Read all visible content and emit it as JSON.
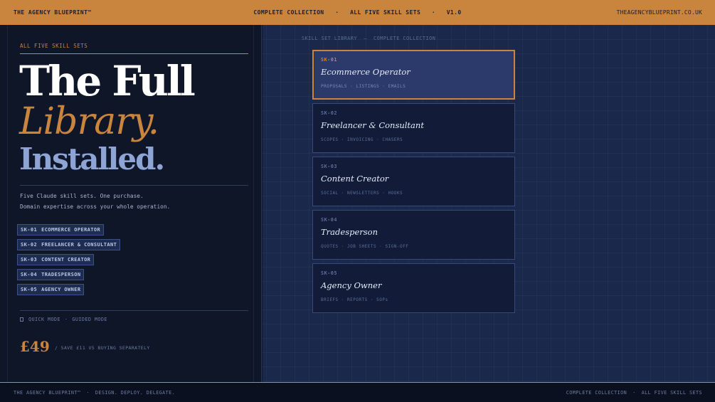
{
  "topbar": {
    "brand": "THE AGENCY BLUEPRINT™",
    "center_a": "COMPLETE COLLECTION",
    "center_b": "ALL FIVE SKILL SETS",
    "center_c": "V1.0",
    "separator": "·",
    "site": "THEAGENCYBLUEPRINT.CO.UK"
  },
  "hero": {
    "eyebrow": "ALL FIVE SKILL SETS",
    "line1": "The Full",
    "line2": "Library.",
    "line3": "Installed.",
    "desc_1": "Five Claude skill sets. One purchase.",
    "desc_2": "Domain expertise across your whole operation."
  },
  "chips": [
    {
      "code": "SK-01",
      "label": "ECOMMERCE OPERATOR"
    },
    {
      "code": "SK-02",
      "label": "FREELANCER & CONSULTANT"
    },
    {
      "code": "SK-03",
      "label": "CONTENT CREATOR"
    },
    {
      "code": "SK-04",
      "label": "TRADESPERSON"
    },
    {
      "code": "SK-05",
      "label": "AGENCY OWNER"
    }
  ],
  "modes": {
    "quick": "QUICK MODE",
    "separator": "·",
    "guided": "GUIDED MODE"
  },
  "pricing": {
    "price": "£49",
    "note": "/ SAVE £11 VS BUYING SEPARATELY"
  },
  "library": {
    "label": "SKILL SET LIBRARY",
    "separator": "—",
    "label_b": "COMPLETE COLLECTION",
    "cards": [
      {
        "code": "SK-01",
        "title": "Ecommerce Operator",
        "tags": "PROPOSALS · LISTINGS · EMAILS",
        "active": true
      },
      {
        "code": "SK-02",
        "title": "Freelancer & Consultant",
        "tags": "SCOPES · INVOICING · CHASERS",
        "active": false
      },
      {
        "code": "SK-03",
        "title": "Content Creator",
        "tags": "SOCIAL · NEWSLETTERS · HOOKS",
        "active": false
      },
      {
        "code": "SK-04",
        "title": "Tradesperson",
        "tags": "QUOTES · JOB SHEETS · SIGN-OFF",
        "active": false
      },
      {
        "code": "SK-05",
        "title": "Agency Owner",
        "tags": "BRIEFS · REPORTS · SOPs",
        "active": false
      }
    ]
  },
  "footer": {
    "brand": "THE AGENCY BLUEPRINT™",
    "separator": "·",
    "tagline": "DESIGN. DEPLOY. DELEGATE.",
    "right_a": "COMPLETE COLLECTION",
    "right_b": "ALL FIVE SKILL SETS"
  },
  "colors": {
    "accent": "#c9843d",
    "panel": "#0f1628",
    "canvas": "#19284b",
    "highlight": "#8ea4d4"
  }
}
